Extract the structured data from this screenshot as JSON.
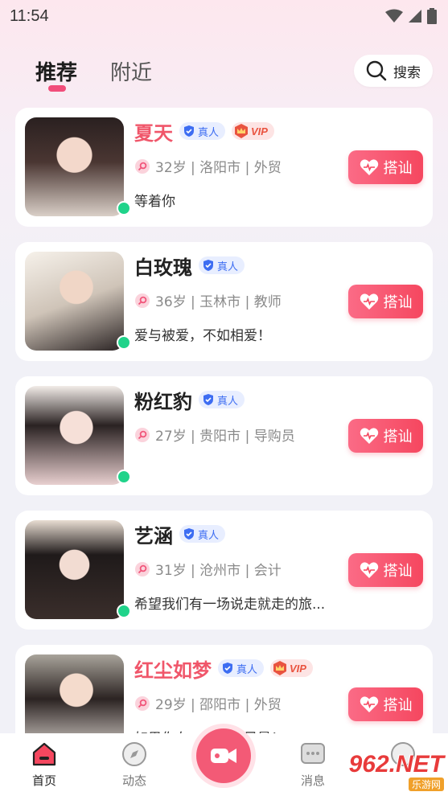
{
  "status_bar": {
    "time": "11:54"
  },
  "tabs": {
    "active": "推荐",
    "inactive": "附近"
  },
  "search": {
    "label": "搜索"
  },
  "greet_label": "搭讪",
  "real_label": "真人",
  "vip_label": "VIP",
  "cards": [
    {
      "name": "夏天",
      "is_vip": true,
      "info": "32岁 | 洛阳市 | 外贸",
      "bio": "等着你"
    },
    {
      "name": "白玫瑰",
      "is_vip": false,
      "info": "36岁 | 玉林市 | 教师",
      "bio": "爱与被爱，不如相爱！"
    },
    {
      "name": "粉红豹",
      "is_vip": false,
      "info": "27岁 | 贵阳市 | 导购员",
      "bio": ""
    },
    {
      "name": "艺涵",
      "is_vip": false,
      "info": "31岁 | 沧州市 | 会计",
      "bio": "希望我们有一场说走就走的旅..."
    },
    {
      "name": "红尘如梦",
      "is_vip": true,
      "info": "29岁 | 邵阳市 | 外贸",
      "bio": "如果你在……我的风景！"
    }
  ],
  "bottom_nav": {
    "home": "首页",
    "feed": "动态",
    "messages": "消息"
  },
  "watermark": {
    "main": "962.NET",
    "sub": "乐游网"
  },
  "colors": {
    "accent": "#f5475f",
    "online": "#20d38a",
    "real_badge": "#3d6df2"
  }
}
